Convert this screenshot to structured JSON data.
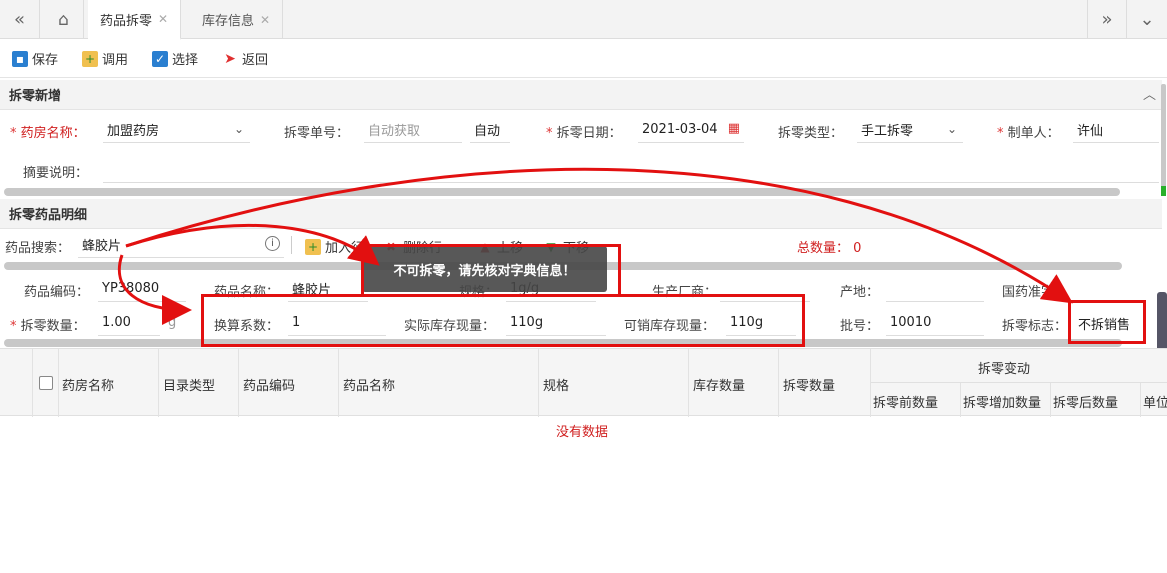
{
  "tabs": [
    {
      "label": "药品拆零",
      "active": true
    },
    {
      "label": "库存信息",
      "active": false
    }
  ],
  "toolbar": {
    "save": "保存",
    "call": "调用",
    "select": "选择",
    "back": "返回"
  },
  "section1": {
    "title": "拆零新增"
  },
  "form": {
    "pharmacy_label": "药房名称：",
    "pharmacy_value": "加盟药房",
    "order_no_label": "拆零单号：",
    "order_no_placeholder": "自动获取",
    "order_no_value": "自动",
    "date_label": "拆零日期：",
    "date_value": "2021-03-04",
    "type_label": "拆零类型：",
    "type_value": "手工拆零",
    "maker_label": "制单人：",
    "maker_value": "许仙",
    "remark_label": "摘要说明："
  },
  "section2": {
    "title": "拆零药品明细"
  },
  "search": {
    "label": "药品搜索：",
    "value": "蜂胶片",
    "add_row": "加入行",
    "del_row": "删除行",
    "up": "上移",
    "down": "下移",
    "total_label": "总数量：",
    "total_value": "0"
  },
  "detail": {
    "code_label": "药品编码：",
    "code_value": "YP38080",
    "name_label": "药品名称：",
    "name_value": "蜂胶片",
    "spec_label": "规格：",
    "spec_value": "1g/g",
    "maker_label": "生产厂商：",
    "origin_label": "产地：",
    "approval_label": "国药准字：",
    "qty_label": "拆零数量：",
    "qty_value": "1.00",
    "qty_unit": "g",
    "factor_label": "换算系数：",
    "factor_value": "1",
    "actual_label": "实际库存现量：",
    "actual_value": "110g",
    "sellable_label": "可销库存现量：",
    "sellable_value": "110g",
    "batch_label": "批号：",
    "batch_value": "10010",
    "flag_label": "拆零标志：",
    "flag_value": "不拆销售"
  },
  "toast": "不可拆零，请先核对字典信息！",
  "grid": {
    "columns": [
      "药房名称",
      "目录类型",
      "药品编码",
      "药品名称",
      "规格",
      "库存数量",
      "拆零数量"
    ],
    "group_title": "拆零变动",
    "sub_columns": [
      "拆零前数量",
      "拆零增加数量",
      "拆零后数量",
      "单位"
    ],
    "empty": "没有数据"
  }
}
